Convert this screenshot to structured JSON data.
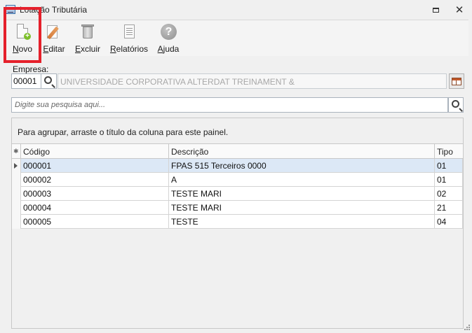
{
  "window": {
    "title": "Lotação Tributária",
    "restore_label": "",
    "close_label": "✕"
  },
  "toolbar": {
    "items": [
      {
        "id": "novo",
        "accel": "N",
        "rest": "ovo",
        "label": "Novo"
      },
      {
        "id": "editar",
        "accel": "E",
        "rest": "ditar",
        "label": "Editar"
      },
      {
        "id": "excluir",
        "accel": "E",
        "rest": "xcluir",
        "label": "Excluir"
      },
      {
        "id": "relatorios",
        "accel": "R",
        "rest": "elatórios",
        "label": "Relatórios"
      },
      {
        "id": "ajuda",
        "accel": "A",
        "rest": "juda",
        "label": "Ajuda"
      }
    ],
    "help_glyph": "?",
    "plus_glyph": "+"
  },
  "empresa": {
    "label": "Empresa:",
    "code": "00001",
    "name": "UNIVERSIDADE CORPORATIVA ALTERDAT TREINAMENT &"
  },
  "search": {
    "placeholder": "Digite sua pesquisa aqui..."
  },
  "group_panel": {
    "text": "Para agrupar, arraste o título da coluna para este painel."
  },
  "grid": {
    "indicator_header": "✱",
    "columns": [
      "Código",
      "Descrição",
      "Tipo"
    ],
    "rows": [
      {
        "codigo": "000001",
        "descricao": "FPAS 515 Terceiros 0000",
        "tipo": "01"
      },
      {
        "codigo": "000002",
        "descricao": "A",
        "tipo": "01"
      },
      {
        "codigo": "000003",
        "descricao": "TESTE MARI",
        "tipo": "02"
      },
      {
        "codigo": "000004",
        "descricao": "TESTE MARI",
        "tipo": "21"
      },
      {
        "codigo": "000005",
        "descricao": "TESTE",
        "tipo": "04"
      }
    ],
    "selected_row": 0
  },
  "colors": {
    "highlight": "#e5202b",
    "selected_row": "#dce8f6"
  }
}
